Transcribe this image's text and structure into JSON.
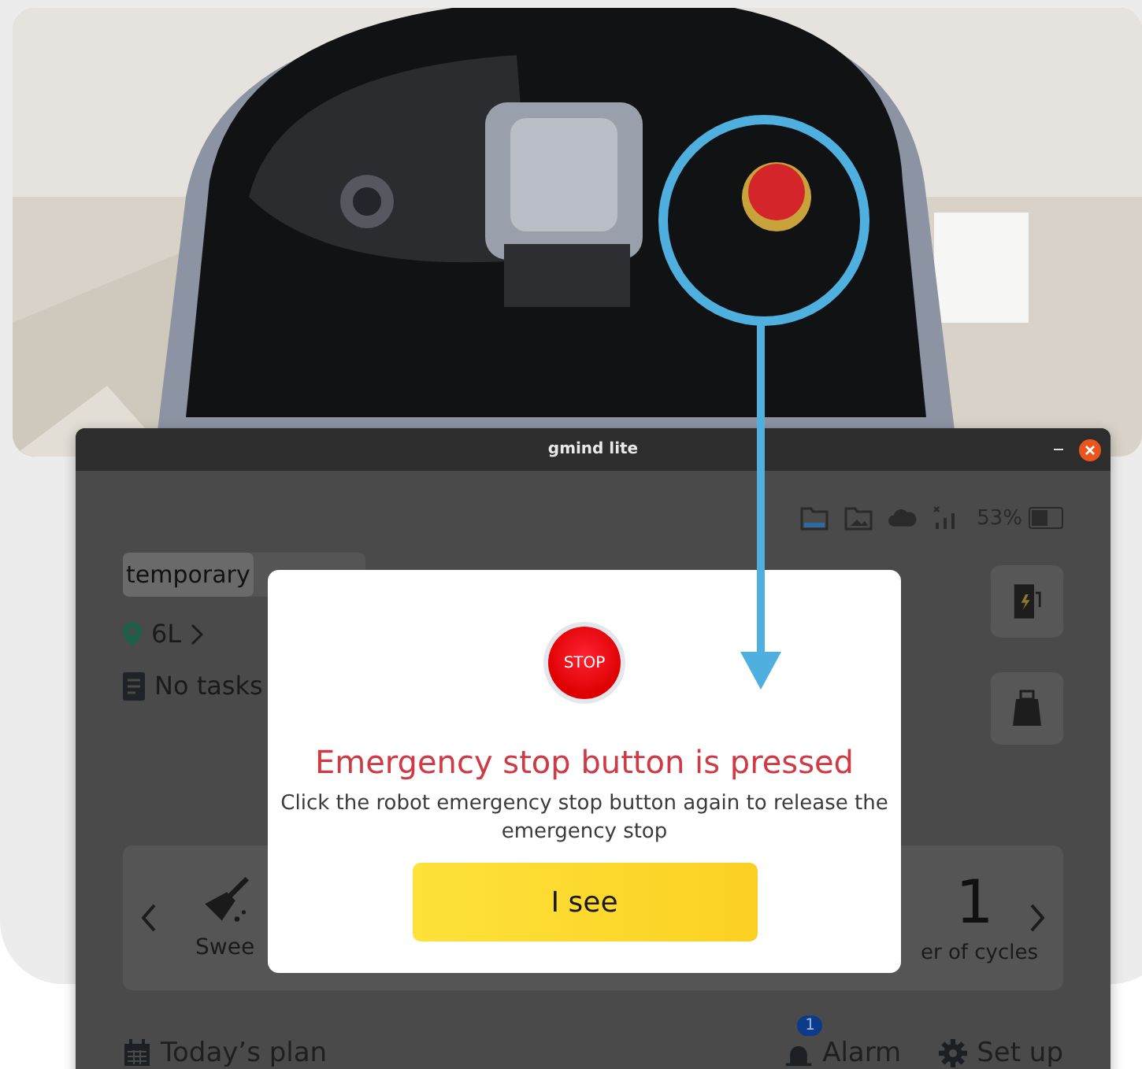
{
  "window": {
    "title": "gmind lite"
  },
  "status_bar": {
    "battery": "53%",
    "level": 0.53
  },
  "tabs": [
    {
      "label": "temporary",
      "selected": true
    }
  ],
  "location": {
    "label": "6L"
  },
  "task_status": "No tasks",
  "task_card": {
    "items": [
      {
        "kind": "mode",
        "label": "Swee"
      },
      {
        "kind": "count",
        "value": "1",
        "label": "er of cycles"
      }
    ]
  },
  "bottom_bar": [
    {
      "kind": "calendar",
      "label": "Today’s plan"
    },
    {
      "kind": "alarm",
      "label": "Alarm",
      "badge": "1"
    },
    {
      "kind": "settings",
      "label": "Set up"
    }
  ],
  "dialog": {
    "icon_text": "STOP",
    "title": "Emergency stop button is pressed",
    "message": "Click the robot emergency stop button again to release the emergency stop",
    "button": "I see"
  }
}
